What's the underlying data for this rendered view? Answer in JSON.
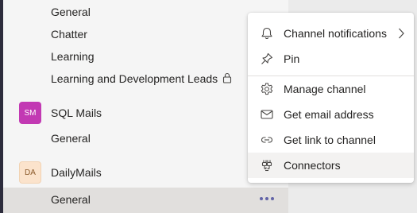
{
  "sidebar": {
    "channels_top": [
      "General",
      "Chatter",
      "Learning",
      "Learning and Development Leads"
    ],
    "teams": [
      {
        "avatar": "SM",
        "name": "SQL Mails",
        "channels": [
          "General"
        ]
      },
      {
        "avatar": "DA",
        "name": "DailyMails",
        "channels": [
          "General"
        ]
      }
    ]
  },
  "context_menu": {
    "items": [
      {
        "label": "Channel notifications",
        "icon": "bell-icon",
        "has_submenu": true
      },
      {
        "label": "Pin",
        "icon": "pin-icon"
      },
      {
        "label": "Manage channel",
        "icon": "gear-icon"
      },
      {
        "label": "Get email address",
        "icon": "mail-icon"
      },
      {
        "label": "Get link to channel",
        "icon": "link-icon"
      },
      {
        "label": "Connectors",
        "icon": "connectors-icon"
      }
    ]
  },
  "colors": {
    "accent": "#6264a7",
    "sql_avatar": "#c239b3",
    "da_avatar": "#fbe3cc"
  }
}
